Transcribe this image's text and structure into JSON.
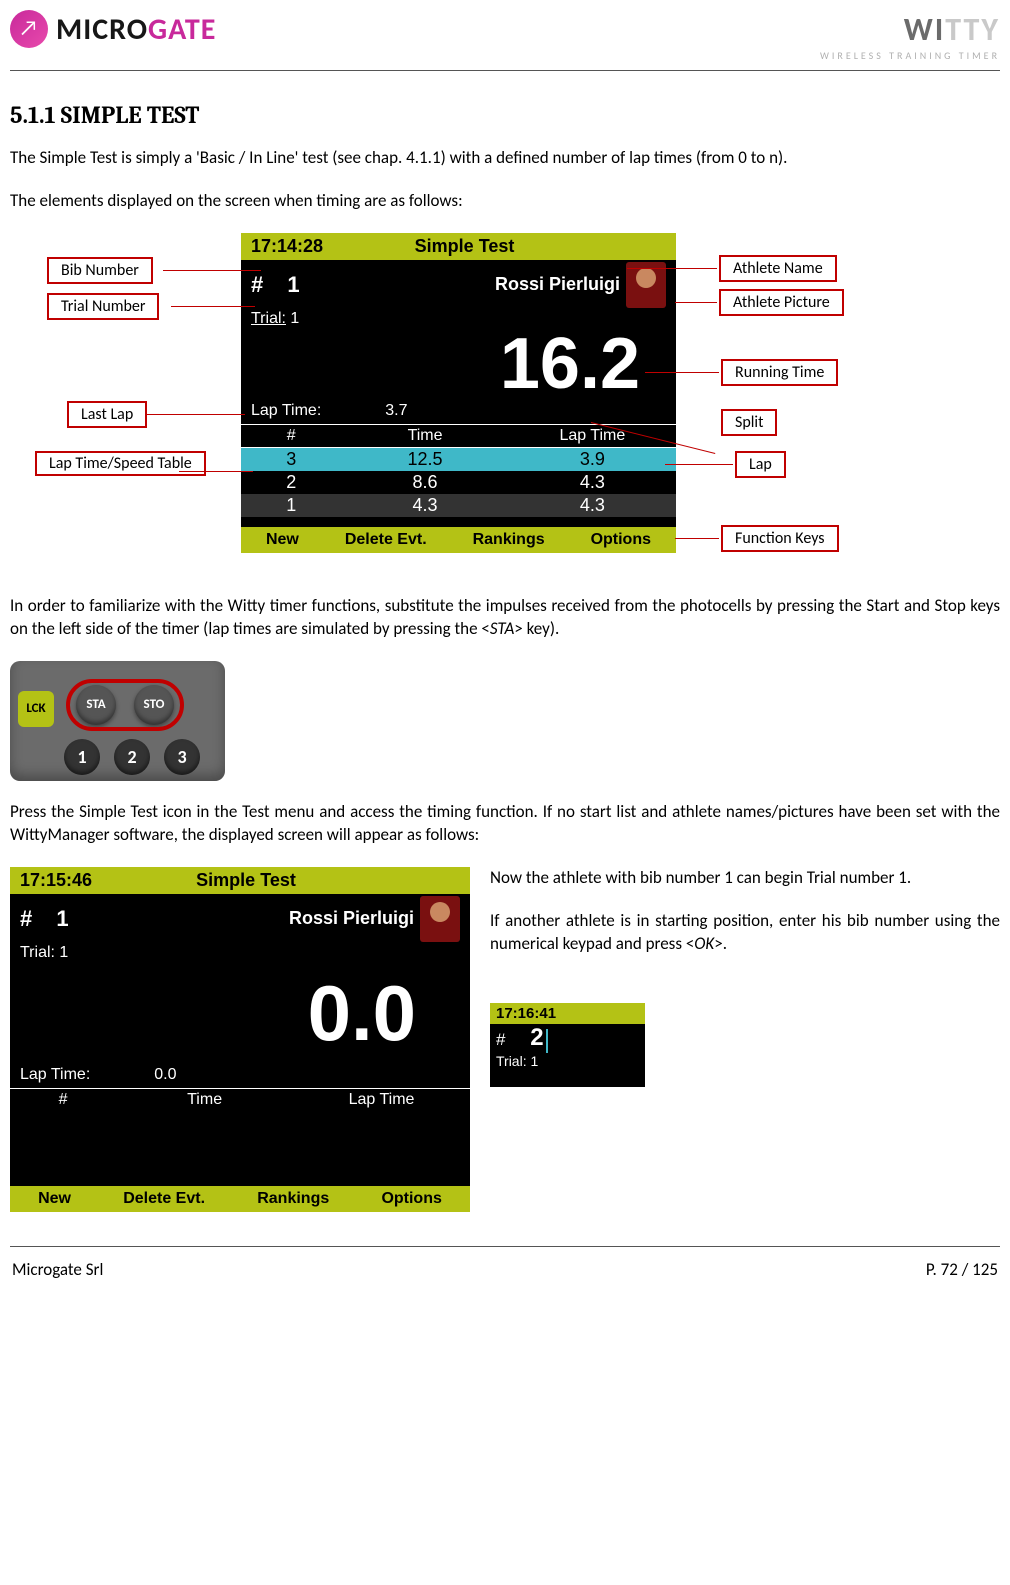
{
  "header": {
    "logo_left_1": "MICRO",
    "logo_left_2": "GATE",
    "logo_right_1": "WI",
    "logo_right_2": "TTY",
    "logo_right_sub": "WIRELESS TRAINING TIMER"
  },
  "section": {
    "number": "5.1.1",
    "title": "SIMPLE TEST"
  },
  "para1": "The Simple Test is simply a 'Basic / In Line' test (see chap. 4.1.1) with a defined number of lap times (from 0 to n).",
  "para2": "The elements displayed on the screen when timing are as follows:",
  "device1": {
    "clock": "17:14:28",
    "title": "Simple  Test",
    "hash": "#",
    "bib": "1",
    "athlete": "Rossi  Pierluigi",
    "trial_lbl": "Trial:",
    "trial_val": "1",
    "bigtime": "16.2",
    "laptime_lbl": "Lap  Time:",
    "laptime_val": "3.7",
    "col_hash": "#",
    "col_time": "Time",
    "col_lap": "Lap  Time",
    "rows": [
      {
        "n": "3",
        "t": "12.5",
        "l": "3.9"
      },
      {
        "n": "2",
        "t": "8.6",
        "l": "4.3"
      },
      {
        "n": "1",
        "t": "4.3",
        "l": "4.3"
      }
    ],
    "fn": [
      "New",
      "Delete  Evt.",
      "Rankings",
      "Options"
    ]
  },
  "callouts": {
    "bib": "Bib Number",
    "trial": "Trial Number",
    "lastlap": "Last Lap",
    "table": "Lap Time/Speed Table",
    "athname": "Athlete Name",
    "athpic": "Athlete Picture",
    "running": "Running Time",
    "split": "Split",
    "lap": "Lap",
    "fkeys": "Function Keys"
  },
  "para3_a": "In order to familiarize with the Witty timer functions, substitute the impulses received from the photocells by pressing the Start and Stop keys on the left side of the timer (lap times are simulated by pressing the <",
  "para3_sta": "STA",
  "para3_b": "> key).",
  "keys": {
    "lck": "LCK",
    "sta": "STA",
    "sto": "STO",
    "k1": "1",
    "k2": "2",
    "k3": "3"
  },
  "para4": "Press the Simple Test icon in the Test menu and access the timing function. If no start list and athlete names/pictures have been set with the WittyManager software, the displayed screen will appear as follows:",
  "device2": {
    "clock": "17:15:46",
    "title": "Simple  Test",
    "hash": "#",
    "bib": "1",
    "athlete": "Rossi  Pierluigi",
    "trial_lbl": "Trial:",
    "trial_val": "1",
    "bigtime": "0.0",
    "laptime_lbl": "Lap  Time:",
    "laptime_val": "0.0",
    "col_hash": "#",
    "col_time": "Time",
    "col_lap": "Lap  Time",
    "fn": [
      "New",
      "Delete  Evt.",
      "Rankings",
      "Options"
    ]
  },
  "right_col": {
    "p1": "Now the athlete with bib number 1 can begin Trial number 1.",
    "p2_a": "If another athlete is in starting position, enter his bib number using the numerical keypad and press <",
    "p2_ok": "OK",
    "p2_b": ">."
  },
  "mini": {
    "clock": "17:16:41",
    "hash": "#",
    "bib": "2",
    "trial_lbl": "Trial:",
    "trial_val": "1"
  },
  "footer": {
    "left": "Microgate Srl",
    "right": "P. 72 / 125"
  }
}
